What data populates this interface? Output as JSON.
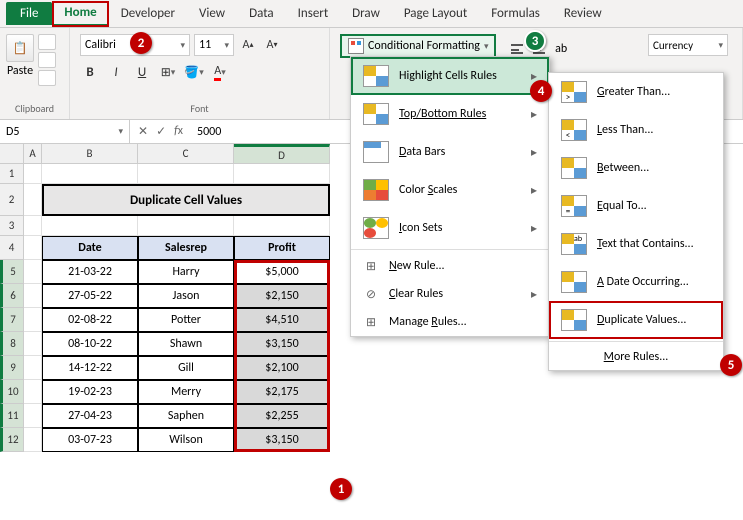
{
  "tabs": {
    "file": "File",
    "home": "Home",
    "developer": "Developer",
    "view": "View",
    "data": "Data",
    "insert": "Insert",
    "draw": "Draw",
    "pagelayout": "Page Layout",
    "formulas": "Formulas",
    "review": "Review"
  },
  "ribbon": {
    "paste": "Paste",
    "clipboard_label": "Clipboard",
    "font_name": "Calibri",
    "font_size": "11",
    "font_label": "Font",
    "cf_label": "Conditional Formatting",
    "number_format": "Currency"
  },
  "namebox": "D5",
  "formula": "5000",
  "col_headers": [
    "A",
    "B",
    "C",
    "D"
  ],
  "row_headers": [
    "1",
    "2",
    "3",
    "4",
    "5",
    "6",
    "7",
    "8",
    "9",
    "10",
    "11",
    "12"
  ],
  "title": "Duplicate Cell Values",
  "table": {
    "headers": [
      "Date",
      "Salesrep",
      "Profit"
    ],
    "rows": [
      {
        "date": "21-03-22",
        "rep": "Harry",
        "profit": "$5,000"
      },
      {
        "date": "27-05-22",
        "rep": "Jason",
        "profit": "$2,150"
      },
      {
        "date": "02-08-22",
        "rep": "Potter",
        "profit": "$4,510"
      },
      {
        "date": "08-10-22",
        "rep": "Shawn",
        "profit": "$3,150"
      },
      {
        "date": "14-12-22",
        "rep": "Gill",
        "profit": "$2,100"
      },
      {
        "date": "19-02-23",
        "rep": "Merry",
        "profit": "$2,175"
      },
      {
        "date": "27-04-23",
        "rep": "Saphen",
        "profit": "$2,255"
      },
      {
        "date": "03-07-23",
        "rep": "Wilson",
        "profit": "$3,150"
      }
    ]
  },
  "menu1": {
    "highlight": "Highlight Cells Rules",
    "topbottom": "Top/Bottom Rules",
    "databars": "Data Bars",
    "colorscales": "Color Scales",
    "iconsets": "Icon Sets",
    "newrule": "New Rule...",
    "clearrules": "Clear Rules",
    "managerules": "Manage Rules..."
  },
  "menu2": {
    "greater": "Greater Than...",
    "less": "Less Than...",
    "between": "Between...",
    "equal": "Equal To...",
    "textcontains": "Text that Contains...",
    "dateoccurring": "A Date Occurring...",
    "duplicate": "Duplicate Values...",
    "morerules": "More Rules..."
  },
  "badges": {
    "b1": "1",
    "b2": "2",
    "b3": "3",
    "b4": "4",
    "b5": "5"
  }
}
